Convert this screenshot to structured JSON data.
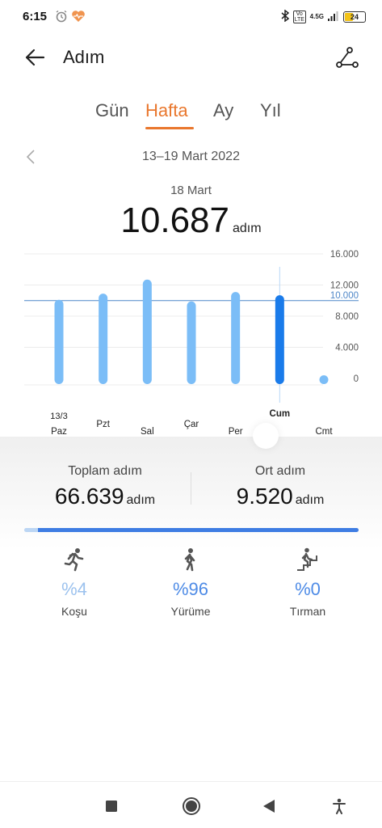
{
  "status": {
    "time": "6:15",
    "network": "4.5G",
    "volte": "Vo LTE",
    "battery": "24"
  },
  "header": {
    "title": "Adım"
  },
  "tabs": [
    {
      "label": "Gün",
      "active": false
    },
    {
      "label": "Hafta",
      "active": true
    },
    {
      "label": "Ay",
      "active": false
    },
    {
      "label": "Yıl",
      "active": false
    }
  ],
  "range": {
    "label": "13–19 Mart 2022"
  },
  "selected": {
    "date": "18 Mart",
    "value": "10.687",
    "unit": "adım"
  },
  "chart_data": {
    "type": "bar",
    "categories": [
      "Paz",
      "Pzt",
      "Sal",
      "Çar",
      "Per",
      "Cum",
      "Cmt"
    ],
    "first_date": "13/3",
    "values": [
      10100,
      10900,
      12700,
      9900,
      11100,
      10687,
      400
    ],
    "selected_index": 5,
    "y_ticks": [
      "16.000",
      "12.000",
      "8.000",
      "4.000",
      "0"
    ],
    "ylim": [
      0,
      16000
    ],
    "goal_value": 10000,
    "goal_label": "10.000",
    "colors": {
      "bar": "#7bbdf7",
      "selected": "#1a7bea",
      "goal": "#4f87c8"
    }
  },
  "summary": {
    "total_label": "Toplam adım",
    "total_value": "66.639",
    "avg_label": "Ort adım",
    "avg_value": "9.520",
    "unit": "adım"
  },
  "breakdown": {
    "progress": {
      "run": 0.04,
      "walk": 0.96
    },
    "items": [
      {
        "icon": "running-icon",
        "pct": "%4",
        "label": "Koşu",
        "color": "#9cc2ee"
      },
      {
        "icon": "walking-icon",
        "pct": "%96",
        "label": "Yürüme",
        "color": "#4e8be6"
      },
      {
        "icon": "climbing-icon",
        "pct": "%0",
        "label": "Tırman",
        "color": "#4e8be6"
      }
    ]
  }
}
